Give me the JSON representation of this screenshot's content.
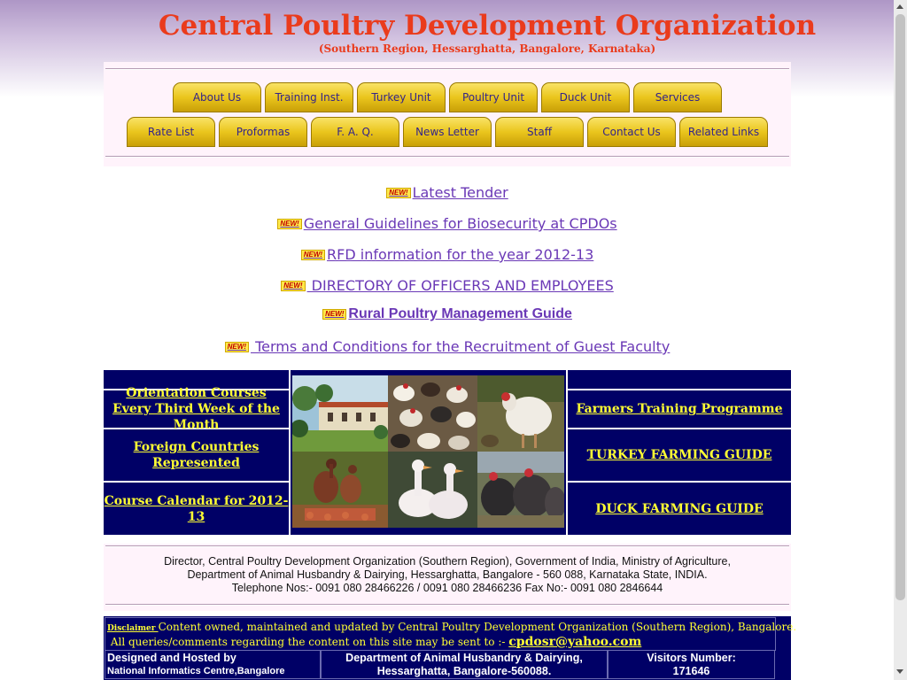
{
  "header": {
    "title": "Central Poultry Development Organization",
    "subtitle": "(Southern Region, Hessarghatta, Bangalore, Karnataka)"
  },
  "nav": {
    "row1": [
      "About Us",
      "Training Inst.",
      "Turkey Unit",
      "Poultry Unit",
      "Duck Unit",
      "Services"
    ],
    "row2": [
      "Rate List",
      "Proformas",
      "F. A. Q.",
      "News Letter",
      "Staff",
      "Contact Us",
      "Related Links"
    ]
  },
  "news": {
    "badge": "NEW!",
    "items": [
      "Latest Tender",
      "General Guidelines for Biosecurity at CPDOs",
      "RFD information for the year 2012-13",
      " DIRECTORY OF OFFICERS AND EMPLOYEES",
      "Rural Poultry Management Guide",
      " Terms and Conditions for the Recruitment of Guest Faculty"
    ]
  },
  "links_table": {
    "left": [
      "Orientation Courses  Every Third Week of the Month ",
      "Foreign Countries  Represented",
      "Course Calendar for 2012-13"
    ],
    "right": [
      "Farmers Training Programme",
      "TURKEY FARMING GUIDE",
      "DUCK FARMING GUIDE"
    ]
  },
  "address": {
    "line1": "Director, Central Poultry Development Organization (Southern Region), Government of India, Ministry of Agriculture,",
    "line2": "Department of Animal Husbandry & Dairying, Hessarghatta, Bangalore - 560 088, Karnataka State, INDIA.",
    "line3": "Telephone Nos:- 0091 080 28466226 / 0091 080 28466236 Fax No:- 0091 080 2846644"
  },
  "bottom": {
    "disclaimer_label": "Disclaimer ",
    "disclaimer_text": "Content owned, maintained and updated by Central Poultry Development Organization (Southern Region), Bangalore.",
    "queries_text": " All queries/comments regarding the content on this site may be sent to :- ",
    "email": "cpdosr@yahoo.com",
    "hosted_label": "Designed and Hosted by",
    "hosted_by": "National Informatics Centre,Bangalore",
    "dept_line1": "Department of Animal Husbandry & Dairying,",
    "dept_line2": "Hessarghatta, Bangalore-560088.",
    "visitors_label": "Visitors Number:",
    "visitors_count": "171646"
  },
  "colors": {
    "title_red": "#ea3b1c",
    "nav_gold": "#eac51d",
    "navy": "#000066",
    "link_yellow": "#ffff33",
    "link_purple": "#6a38b6"
  }
}
